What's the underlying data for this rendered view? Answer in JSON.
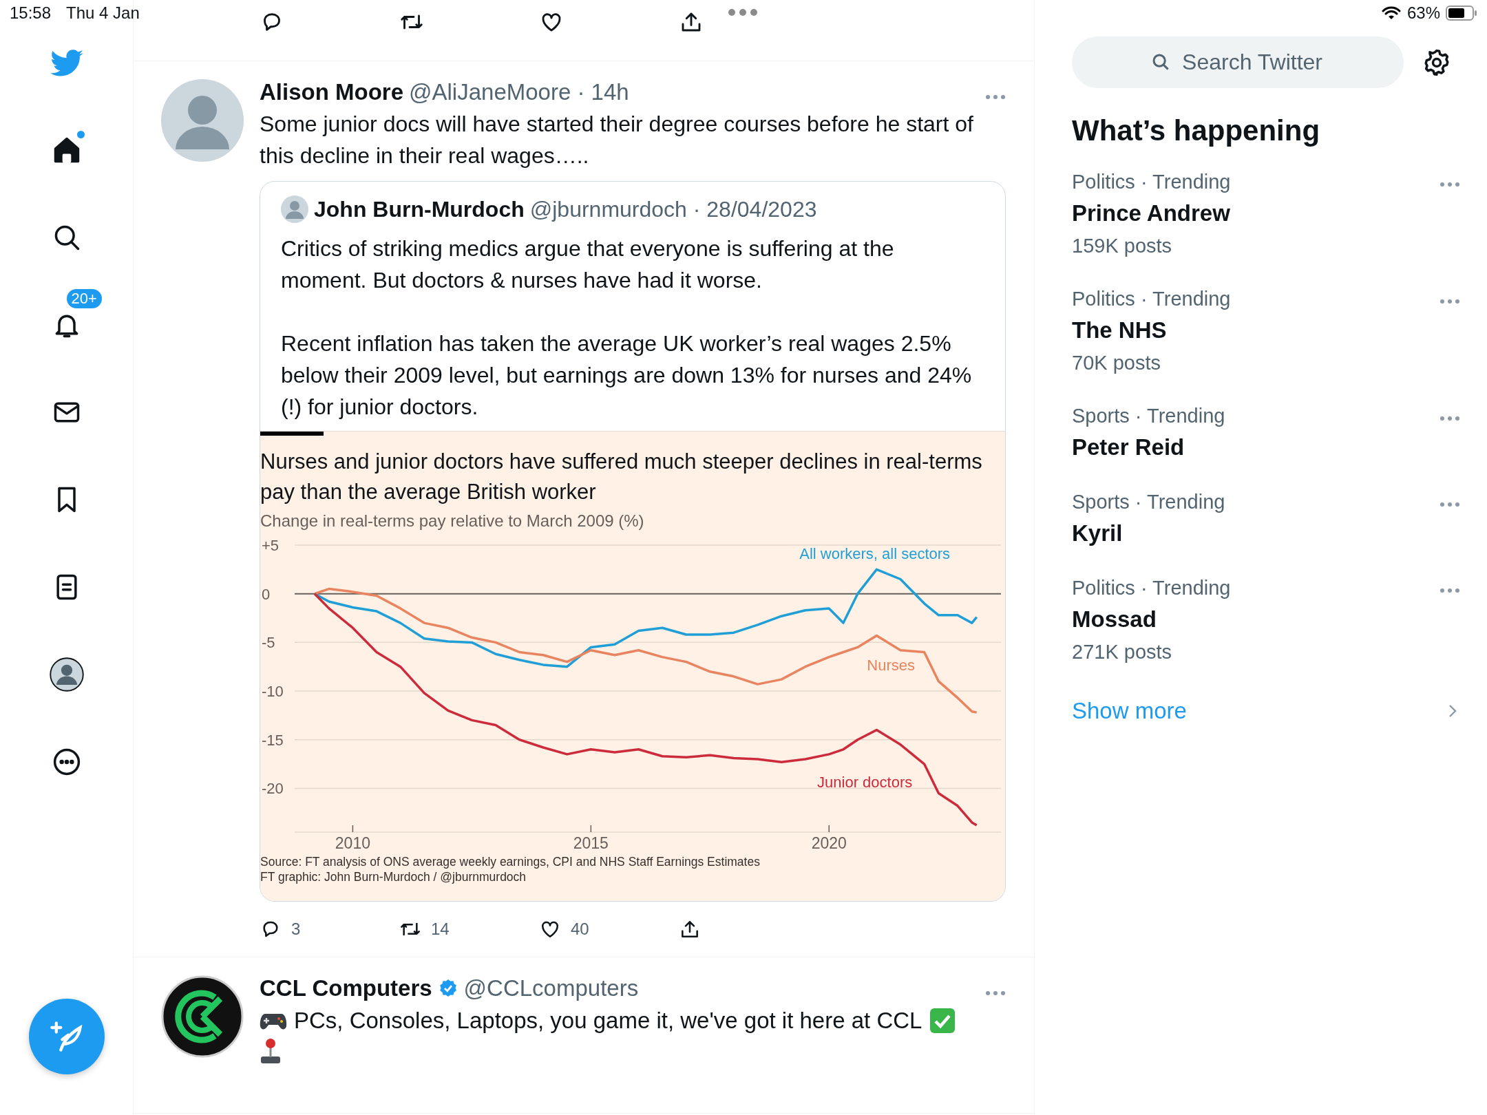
{
  "status_bar": {
    "time": "15:58",
    "date": "Thu 4 Jan",
    "battery": "63%"
  },
  "sidebar": {
    "home_dot": true,
    "notifications_badge": "20+"
  },
  "tweets": [
    {
      "kind": "quote_tweet",
      "name": "Alison Moore",
      "meta": "@AliJaneMoore · 14h",
      "text": "Some junior docs will have started their degree courses before he start of this decline in their real wages…..",
      "quote": {
        "name": "John Burn-Murdoch",
        "meta": "@jburnmurdoch · 28/04/2023",
        "paragraphs": [
          "Critics of striking medics argue that everyone is suffering at the moment. But doctors & nurses have had it worse.",
          "Recent inflation has taken the average UK worker’s real wages 2.5% below their 2009 level, but earnings are down 13% for nurses and 24% (!) for junior doctors."
        ],
        "chart_data": {
          "type": "line",
          "title": "Nurses and junior doctors have suffered much steeper declines in real-terms pay than the average British worker",
          "ylabel": "Change in real-terms pay relative to March 2009 (%)",
          "x": [
            2009.2,
            2009.5,
            2010,
            2010.5,
            2011,
            2011.5,
            2012,
            2012.5,
            2013,
            2013.5,
            2014,
            2014.5,
            2015,
            2015.5,
            2016,
            2016.5,
            2017,
            2017.5,
            2018,
            2018.5,
            2019,
            2019.5,
            2020,
            2020.3,
            2020.6,
            2021,
            2021.5,
            2022,
            2022.3,
            2022.7,
            2023,
            2023.1
          ],
          "series": [
            {
              "name": "All workers, all sectors",
              "color": "#1f9fd6",
              "values": [
                0,
                -0.8,
                -1.4,
                -1.8,
                -3,
                -4.6,
                -4.9,
                -5,
                -6.2,
                -6.8,
                -7.3,
                -7.5,
                -5.5,
                -5.2,
                -3.8,
                -3.5,
                -4.2,
                -4.2,
                -4,
                -3.2,
                -2.3,
                -1.7,
                -1.5,
                -3,
                0,
                2.5,
                1.5,
                -1,
                -2.2,
                -2.2,
                -3,
                -2.4
              ]
            },
            {
              "name": "Nurses",
              "color": "#e8845f",
              "values": [
                0,
                0.5,
                0.2,
                -0.2,
                -1.5,
                -3,
                -3.5,
                -4.5,
                -5,
                -6,
                -6.3,
                -7,
                -5.8,
                -6.3,
                -5.8,
                -6.5,
                -7,
                -8,
                -8.5,
                -9.3,
                -8.8,
                -7.5,
                -6.5,
                -6,
                -5.5,
                -4.3,
                -5.8,
                -6,
                -9,
                -10.7,
                -12.1,
                -12.2
              ]
            },
            {
              "name": "Junior doctors",
              "color": "#cc2b3b",
              "values": [
                0,
                -1.5,
                -3.5,
                -6,
                -7.5,
                -10.2,
                -12,
                -13,
                -13.5,
                -15,
                -15.8,
                -16.5,
                -16,
                -16.3,
                -16,
                -16.7,
                -16.8,
                -16.6,
                -16.9,
                -17,
                -17.3,
                -17,
                -16.5,
                -16,
                -15,
                -14,
                -15.5,
                -17.5,
                -20.5,
                -21.8,
                -23.5,
                -23.8
              ]
            }
          ],
          "xlim": [
            2008.78,
            2023.61
          ],
          "ylim": [
            -24.5,
            5
          ],
          "xticks": [
            2010,
            2015,
            2020
          ],
          "yticks": [
            {
              "value": 5,
              "label": "+5"
            },
            0,
            -5,
            -10,
            -15,
            -20
          ],
          "grid": true
        },
        "source": "Source: FT analysis of ONS average weekly earnings, CPI and NHS Staff Earnings Estimates",
        "credit": "FT graphic: John Burn-Murdoch / @jburnmurdoch"
      },
      "actions": [
        {
          "kind": "reply",
          "count": "3"
        },
        {
          "kind": "retweet",
          "count": "14"
        },
        {
          "kind": "like",
          "count": "40"
        },
        {
          "kind": "share"
        }
      ]
    },
    {
      "kind": "tweet",
      "name": "CCL Computers",
      "verified": true,
      "meta": "@CCLcomputers",
      "text": "PCs, Consoles, Laptops, you game it, we've got it here at CCL"
    }
  ],
  "search": {
    "placeholder": "Search Twitter"
  },
  "trends_title": "What’s happening",
  "trends": [
    {
      "category": "Politics · Trending",
      "title": "Prince Andrew",
      "posts": "159K posts"
    },
    {
      "category": "Politics · Trending",
      "title": "The NHS",
      "posts": "70K posts"
    },
    {
      "category": "Sports · Trending",
      "title": "Peter Reid"
    },
    {
      "category": "Sports · Trending",
      "title": "Kyril"
    },
    {
      "category": "Politics · Trending",
      "title": "Mossad",
      "posts": "271K posts"
    }
  ],
  "show_more": "Show more"
}
